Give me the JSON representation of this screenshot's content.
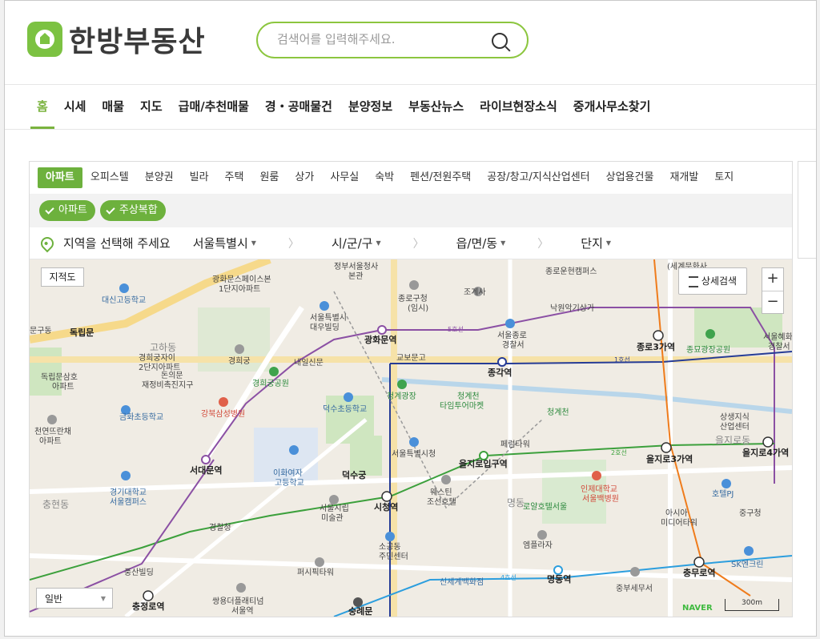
{
  "header": {
    "logo_text": "한방부동산",
    "search_placeholder": "검색어를 입력해주세요."
  },
  "nav": [
    "홈",
    "시세",
    "매물",
    "지도",
    "급매/추천매물",
    "경・공매물건",
    "분양정보",
    "부동산뉴스",
    "라이브현장소식",
    "중개사무소찾기"
  ],
  "property_tabs": [
    "아파트",
    "오피스텔",
    "분양권",
    "빌라",
    "주택",
    "원룸",
    "상가",
    "사무실",
    "숙박",
    "펜션/전원주택",
    "공장/창고/지식산업센터",
    "상업용건물",
    "재개발",
    "토지"
  ],
  "filter_chips": [
    "아파트",
    "주상복합"
  ],
  "region": {
    "prompt": "지역을 선택해 주세요",
    "city": "서울특별시",
    "district": "시/군/구",
    "town": "읍/면/동",
    "complex": "단지"
  },
  "map": {
    "cadastral_label": "지적도",
    "detail_search_label": "상세검색",
    "zoom_in": "+",
    "zoom_out": "−",
    "map_type": "일반",
    "brand": "NAVER",
    "scale": "300m",
    "labels": {
      "l1": "정부서울청사",
      "l2": "본관",
      "l3": "광화문스페이스본",
      "l4": "1단지아파트",
      "l5": "대신고등학교",
      "l6": "종로구청",
      "l7": "(임시)",
      "l8": "조계사",
      "l9": "서울특별시",
      "l10": "대우빌딩",
      "l11": "광화문역",
      "l12": "5호선",
      "l13": "낙원악기상가",
      "l14": "서울종로",
      "l15": "경찰서",
      "l16": "종로3가역",
      "l17": "종묘광장공원",
      "l18": "교보문고",
      "l19": "종각역",
      "l20": "1호선",
      "l21": "독립문",
      "l22": "경희궁자이",
      "l23": "2단지아파트",
      "l24": "돈의문",
      "l25": "재정비촉진지구",
      "l26": "내일신문",
      "l27": "경희궁",
      "l28": "경희궁공원",
      "l29": "청계광장",
      "l30": "청계천",
      "l31": "타임투어마켓",
      "l32": "청계천",
      "l33": "상생지식",
      "l34": "산업센터",
      "l35": "독립문삼호",
      "l36": "아파트",
      "l37": "금화초등학교",
      "l38": "강북삼성병원",
      "l39": "덕수초등학교",
      "l40": "천연뜨란채",
      "l41": "아파트",
      "l42": "페럼타워",
      "l43": "을지로동",
      "l44": "서울특별시청",
      "l45": "을지로입구역",
      "l46": "2호선",
      "l47": "을지로3가역",
      "l48": "을지로4가역",
      "l49": "서대문역",
      "l50": "이화여자",
      "l51": "고등학교",
      "l52": "덕수궁",
      "l53": "인제대학교",
      "l54": "서울백병원",
      "l55": "호텔PJ",
      "l56": "경기대학교",
      "l57": "서울캠퍼스",
      "l58": "충현동",
      "l59": "서울시립",
      "l60": "미술관",
      "l61": "시청역",
      "l62": "웨스틴",
      "l63": "조선호텔",
      "l64": "명동",
      "l65": "로얄호텔서울",
      "l66": "아시아",
      "l67": "미디어타워",
      "l68": "중구청",
      "l69": "경찰청",
      "l70": "소공동",
      "l71": "주민센터",
      "l72": "엠플라자",
      "l73": "풍산빌딩",
      "l74": "퍼시픽타워",
      "l75": "신세계백화점",
      "l76": "4호선",
      "l77": "명동역",
      "l78": "충무로역",
      "l79": "SK엔크린",
      "l80": "중부세무서",
      "l81": "충정로역",
      "l82": "쌍용더플래티넘",
      "l83": "서울역",
      "l84": "숭례문",
      "l85": "문구동",
      "l86": "서울혜화",
      "l87": "경찰서",
      "l88": "고하동",
      "l89": "종로운현캠퍼스",
      "l90": "(세계문화사"
    }
  },
  "colors": {
    "brand_green": "#6db13d",
    "line1": "#263c96",
    "line2": "#3ca03c",
    "line3": "#ef7c1c",
    "line4": "#2c9ede",
    "line5": "#8b50a4"
  }
}
